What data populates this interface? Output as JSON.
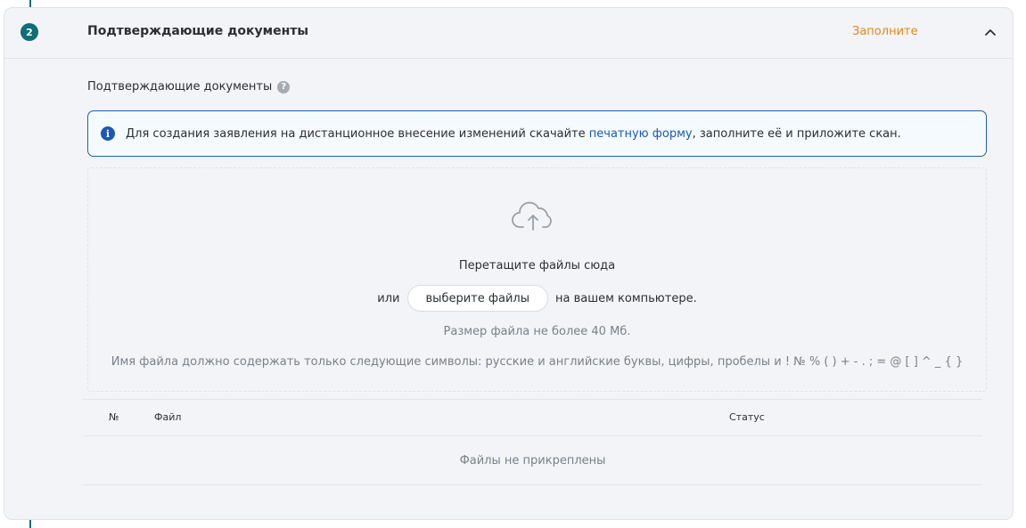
{
  "step": {
    "number": "2"
  },
  "section": {
    "title": "Подтверждающие документы",
    "status": "Заполните",
    "collapse_icon": "chevron-up-icon"
  },
  "field": {
    "label": "Подтверждающие документы",
    "help_icon": "question-circle-icon",
    "help_glyph": "?"
  },
  "info": {
    "icon": "info-circle-icon",
    "icon_glyph": "i",
    "text_before": "Для создания заявления на дистанционное внесение изменений скачайте ",
    "link_text": "печатную форму",
    "text_after": ", заполните её и приложите скан."
  },
  "upload": {
    "icon": "cloud-upload-icon",
    "drop_text": "Перетащите файлы сюда",
    "or_text": "или",
    "choose_button": "выберите файлы",
    "after_button": "на вашем компьютере.",
    "size_limit": "Размер файла не более 40 Мб.",
    "allowed_chars": "Имя файла должно содержать только следующие символы: русские и английские буквы, цифры, пробелы и ! № % ( ) + - . ; = @ [ ] ^ _ { }"
  },
  "table": {
    "columns": [
      "№",
      "Файл",
      "Статус"
    ],
    "empty_text": "Файлы не прикреплены"
  },
  "colors": {
    "accent": "#0f6e78",
    "status": "#e8870e",
    "link": "#1a58b5"
  }
}
